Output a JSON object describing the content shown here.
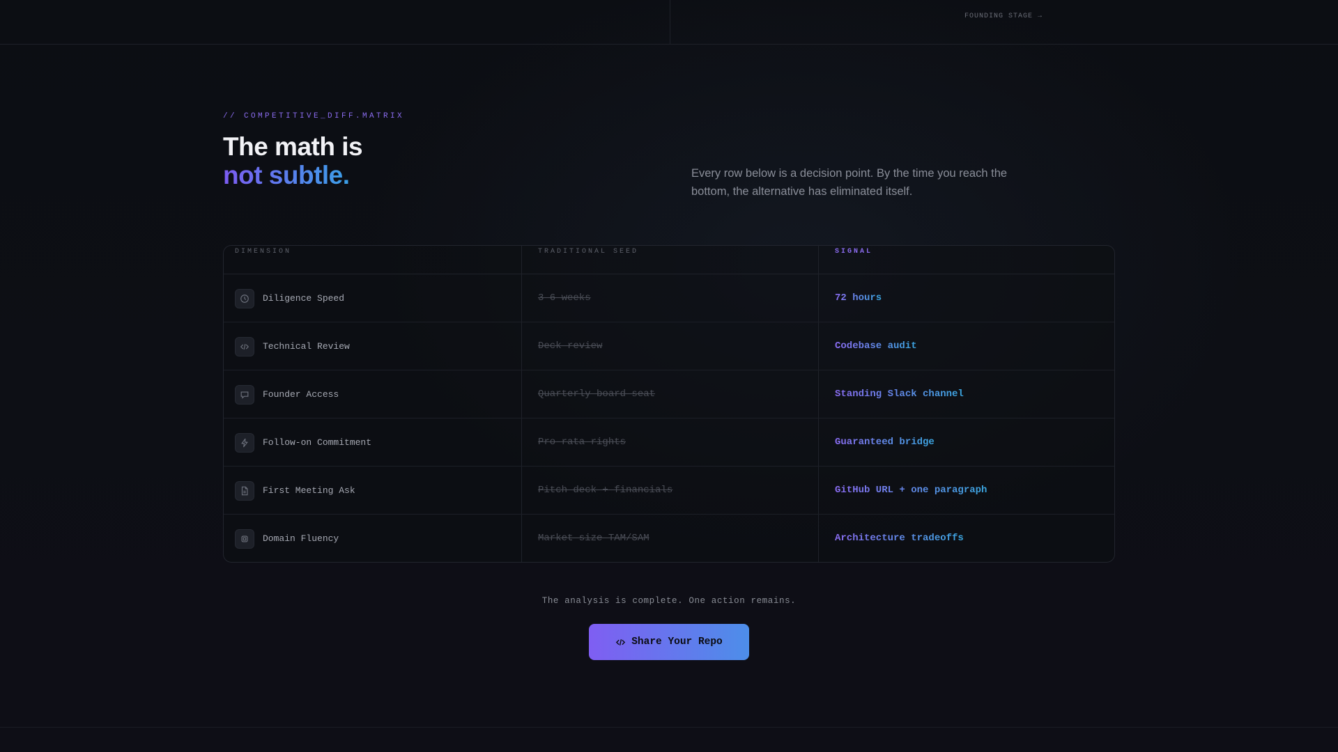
{
  "topbar": {
    "stage_link": "FOUNDING STAGE →"
  },
  "section": {
    "eyebrow": "// COMPETITIVE_DIFF.MATRIX",
    "headline_line1": "The math is",
    "headline_line2": "not subtle.",
    "intro": "Every row below is a decision point. By the time you reach the bottom, the alternative has eliminated itself."
  },
  "matrix": {
    "headers": {
      "dimension": "DIMENSION",
      "traditional": "TRADITIONAL SEED",
      "signal": "SIGNAL"
    },
    "rows": [
      {
        "icon": "clock-icon",
        "dimension": "Diligence Speed",
        "traditional": "3–6 weeks",
        "signal": "72 hours"
      },
      {
        "icon": "code-icon",
        "dimension": "Technical Review",
        "traditional": "Deck review",
        "signal": "Codebase audit"
      },
      {
        "icon": "chat-icon",
        "dimension": "Founder Access",
        "traditional": "Quarterly board seat",
        "signal": "Standing Slack channel"
      },
      {
        "icon": "bolt-icon",
        "dimension": "Follow-on Commitment",
        "traditional": "Pro-rata rights",
        "signal": "Guaranteed bridge"
      },
      {
        "icon": "document-icon",
        "dimension": "First Meeting Ask",
        "traditional": "Pitch deck + financials",
        "signal": "GitHub URL + one paragraph"
      },
      {
        "icon": "chip-icon",
        "dimension": "Domain Fluency",
        "traditional": "Market size TAM/SAM",
        "signal": "Architecture tradeoffs"
      }
    ]
  },
  "closing": {
    "text": "The analysis is complete. One action remains.",
    "cta_label": "Share Your Repo",
    "cta_icon": "code-icon"
  },
  "colors": {
    "background": "#0d0e14",
    "accent_purple": "#8b6cf0",
    "accent_blue": "#3aa0e8"
  }
}
